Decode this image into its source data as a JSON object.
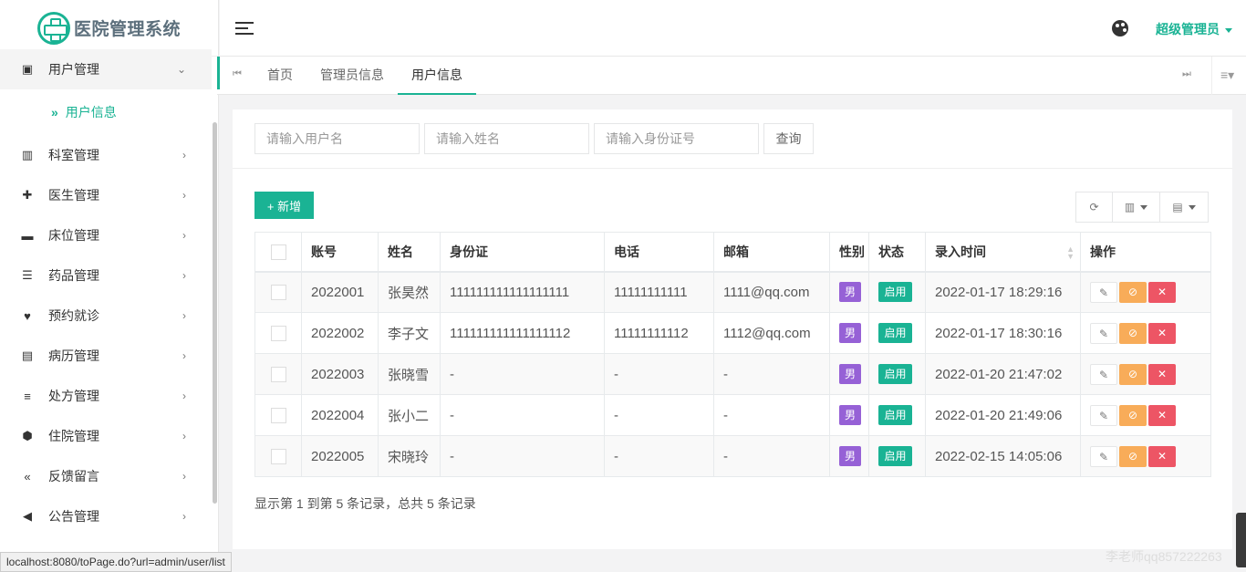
{
  "app": {
    "logo_text": "医院管理系统",
    "accent_color": "#1ab394"
  },
  "sidebar": {
    "items": [
      {
        "label": "用户管理",
        "icon": "id-card-icon",
        "expanded": true
      },
      {
        "label": "科室管理",
        "icon": "columns-icon"
      },
      {
        "label": "医生管理",
        "icon": "user-plus-icon"
      },
      {
        "label": "床位管理",
        "icon": "bed-icon"
      },
      {
        "label": "药品管理",
        "icon": "list-icon"
      },
      {
        "label": "预约就诊",
        "icon": "heartbeat-icon"
      },
      {
        "label": "病历管理",
        "icon": "newspaper-icon"
      },
      {
        "label": "处方管理",
        "icon": "list-check-icon"
      },
      {
        "label": "住院管理",
        "icon": "hospital-shield-icon"
      },
      {
        "label": "反馈留言",
        "icon": "reply-all-icon"
      },
      {
        "label": "公告管理",
        "icon": "bullhorn-icon"
      }
    ],
    "subitem_active": "用户信息"
  },
  "header": {
    "user_label": "超级管理员"
  },
  "tabs": [
    {
      "label": "首页"
    },
    {
      "label": "管理员信息"
    },
    {
      "label": "用户信息",
      "active": true
    }
  ],
  "search": {
    "username_placeholder": "请输入用户名",
    "name_placeholder": "请输入姓名",
    "idcard_placeholder": "请输入身份证号",
    "query_label": "查询"
  },
  "toolbar": {
    "add_label": "+ 新增",
    "refresh_icon": "refresh-icon",
    "columns_icon": "columns-toggle-icon",
    "export_icon": "export-file-icon"
  },
  "table": {
    "headers": [
      "账号",
      "姓名",
      "身份证",
      "电话",
      "邮箱",
      "性别",
      "状态",
      "录入时间",
      "操作"
    ],
    "rows": [
      {
        "account": "2022001",
        "name": "张昊然",
        "idcard": "111111111111111111",
        "phone": "11111111111",
        "email": "1111@qq.com",
        "gender": "男",
        "status": "启用",
        "time": "2022-01-17 18:29:16"
      },
      {
        "account": "2022002",
        "name": "李子文",
        "idcard": "111111111111111112",
        "phone": "11111111112",
        "email": "1112@qq.com",
        "gender": "男",
        "status": "启用",
        "time": "2022-01-17 18:30:16"
      },
      {
        "account": "2022003",
        "name": "张晓雪",
        "idcard": "-",
        "phone": "-",
        "email": "-",
        "gender": "男",
        "status": "启用",
        "time": "2022-01-20 21:47:02"
      },
      {
        "account": "2022004",
        "name": "张小二",
        "idcard": "-",
        "phone": "-",
        "email": "-",
        "gender": "男",
        "status": "启用",
        "time": "2022-01-20 21:49:06"
      },
      {
        "account": "2022005",
        "name": "宋晓玲",
        "idcard": "-",
        "phone": "-",
        "email": "-",
        "gender": "男",
        "status": "启用",
        "time": "2022-02-15 14:05:06"
      }
    ],
    "footer": "显示第 1 到第 5 条记录，总共 5 条记录"
  },
  "statusbar": {
    "url": "localhost:8080/toPage.do?url=admin/user/list"
  },
  "watermark": "李老师qq857222263"
}
